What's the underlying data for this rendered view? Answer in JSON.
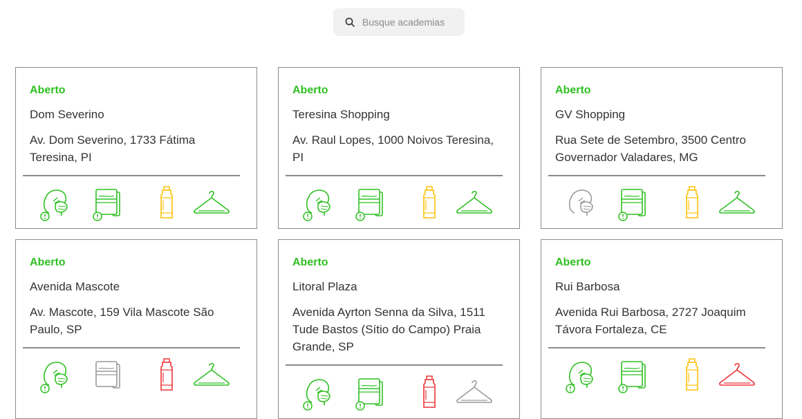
{
  "search": {
    "placeholder": "Busque academias",
    "value": ""
  },
  "colors": {
    "open": "#2fc022",
    "required": "#2fc022",
    "partial": "#ffc107",
    "prohibited": "#ed3237",
    "not_required": "#999999"
  },
  "gyms": [
    {
      "status": "Aberto",
      "name": "Dom Severino",
      "address": "Av. Dom Severino, 1733 Fátima Teresina, PI",
      "icons": [
        {
          "name": "mask-icon",
          "state": "required"
        },
        {
          "name": "towel-icon",
          "state": "required"
        },
        {
          "name": "water-bottle-icon",
          "state": "partial"
        },
        {
          "name": "locker-room-icon",
          "state": "required"
        }
      ]
    },
    {
      "status": "Aberto",
      "name": "Teresina Shopping",
      "address": "Av. Raul Lopes, 1000 Noivos Teresina, PI",
      "icons": [
        {
          "name": "mask-icon",
          "state": "required"
        },
        {
          "name": "towel-icon",
          "state": "required"
        },
        {
          "name": "water-bottle-icon",
          "state": "partial"
        },
        {
          "name": "locker-room-icon",
          "state": "required"
        }
      ]
    },
    {
      "status": "Aberto",
      "name": "GV Shopping",
      "address": "Rua Sete de Setembro, 3500 Centro Governador Valadares, MG",
      "icons": [
        {
          "name": "mask-icon",
          "state": "not_required"
        },
        {
          "name": "towel-icon",
          "state": "required"
        },
        {
          "name": "water-bottle-icon",
          "state": "partial"
        },
        {
          "name": "locker-room-icon",
          "state": "required"
        }
      ]
    },
    {
      "status": "Aberto",
      "name": "Avenida Mascote",
      "address": "Av. Mascote, 159 Vila Mascote São Paulo, SP",
      "icons": [
        {
          "name": "mask-icon",
          "state": "required"
        },
        {
          "name": "towel-icon",
          "state": "not_required"
        },
        {
          "name": "water-bottle-icon",
          "state": "prohibited"
        },
        {
          "name": "locker-room-icon",
          "state": "required"
        }
      ]
    },
    {
      "status": "Aberto",
      "name": "Litoral Plaza",
      "address": "Avenida Ayrton Senna da Silva, 1511 Tude Bastos (Sítio do Campo) Praia Grande, SP",
      "icons": [
        {
          "name": "mask-icon",
          "state": "required"
        },
        {
          "name": "towel-icon",
          "state": "required"
        },
        {
          "name": "water-bottle-icon",
          "state": "prohibited"
        },
        {
          "name": "locker-room-icon",
          "state": "not_required"
        }
      ]
    },
    {
      "status": "Aberto",
      "name": "Rui Barbosa",
      "address": "Avenida Rui Barbosa, 2727 Joaquim Távora Fortaleza, CE",
      "icons": [
        {
          "name": "mask-icon",
          "state": "required"
        },
        {
          "name": "towel-icon",
          "state": "required"
        },
        {
          "name": "water-bottle-icon",
          "state": "partial"
        },
        {
          "name": "locker-room-icon",
          "state": "prohibited"
        }
      ]
    }
  ]
}
